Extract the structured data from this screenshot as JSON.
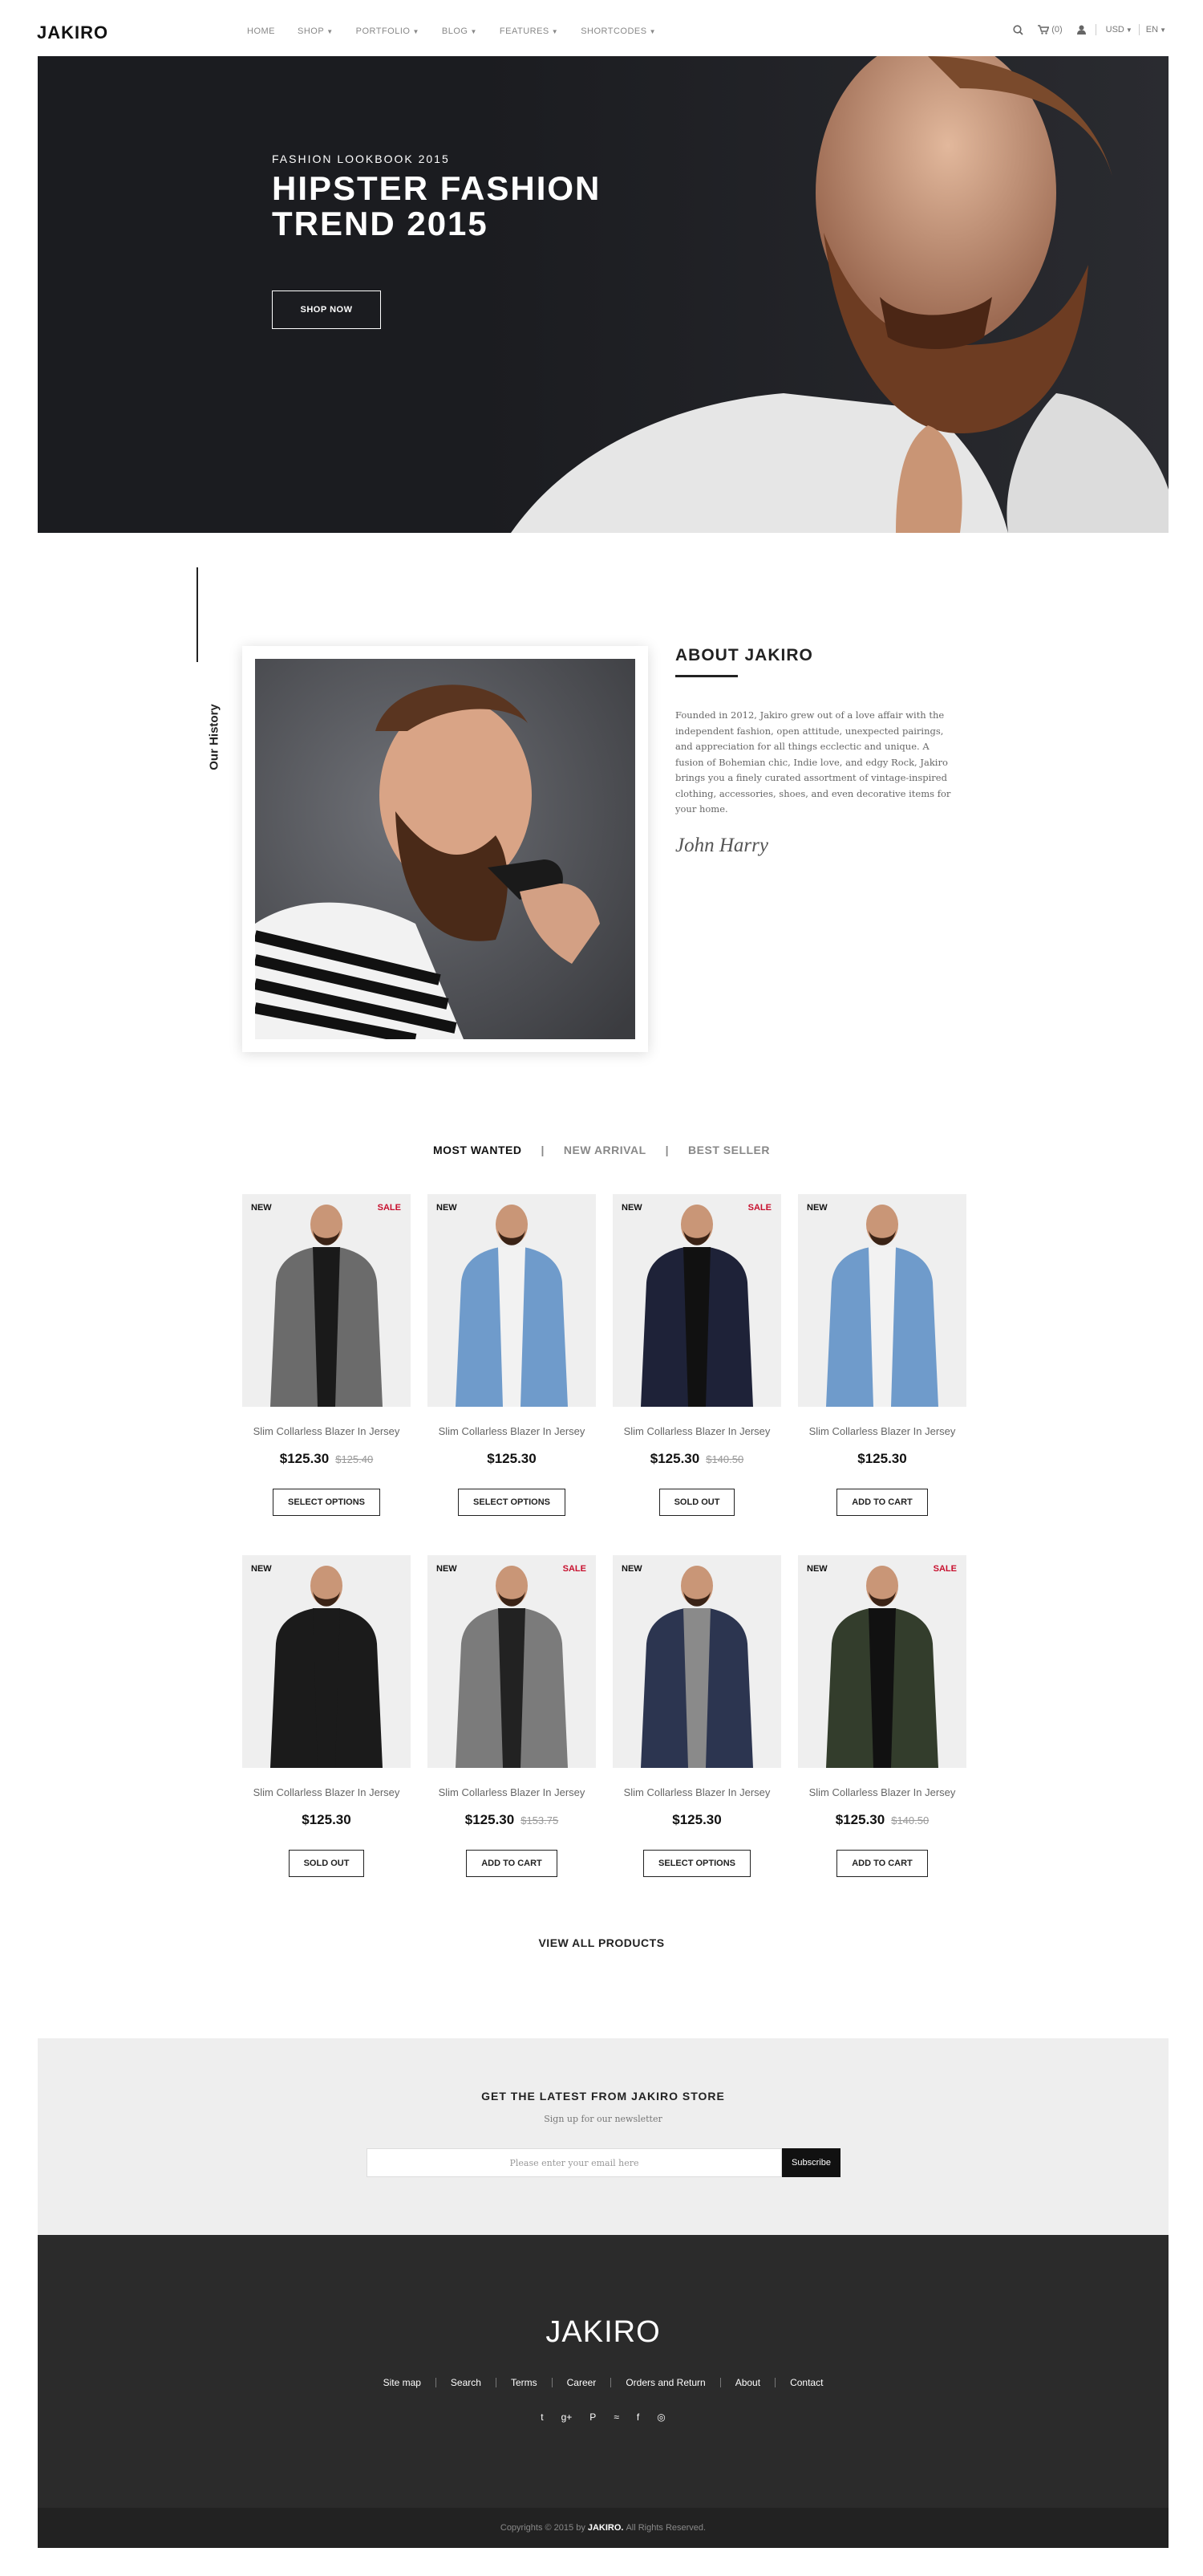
{
  "header": {
    "logo": "JAKIRO",
    "nav": [
      {
        "label": "HOME",
        "dropdown": false
      },
      {
        "label": "SHOP",
        "dropdown": true
      },
      {
        "label": "PORTFOLIO",
        "dropdown": true
      },
      {
        "label": "BLOG",
        "dropdown": true
      },
      {
        "label": "FEATURES",
        "dropdown": true
      },
      {
        "label": "SHORTCODES",
        "dropdown": true
      }
    ],
    "cart_count": "(0)",
    "currency": "USD",
    "language": "EN"
  },
  "hero": {
    "kicker": "FASHION LOOKBOOK 2015",
    "title": "HIPSTER FASHION TREND 2015",
    "button": "SHOP NOW"
  },
  "about": {
    "side_label": "Our History",
    "title": "ABOUT JAKIRO",
    "text": "Founded in 2012, Jakiro grew out of a love affair with the independent fashion, open attitude, unexpected pairings, and appreciation for all things ecclectic and unique. A fusion of Bohemian chic, Indie love, and edgy Rock, Jakiro brings you a finely curated assortment of vintage-inspired clothing, accessories, shoes, and even decorative items for your home.",
    "signature": "John Harry"
  },
  "tabs": [
    "MOST WANTED",
    "NEW ARRIVAL",
    "BEST SELLER"
  ],
  "products": [
    {
      "name": "Slim Collarless Blazer In Jersey",
      "price": "$125.30",
      "old_price": "$125.40",
      "badge_new": "NEW",
      "badge_sale": "SALE",
      "button": "SELECT OPTIONS",
      "jacket": "#6b6b6b",
      "top": "#1a1a1a"
    },
    {
      "name": "Slim Collarless Blazer In Jersey",
      "price": "$125.30",
      "old_price": "",
      "badge_new": "NEW",
      "badge_sale": "",
      "button": "SELECT OPTIONS",
      "jacket": "#6f9bcb",
      "top": "#f2f2f2"
    },
    {
      "name": "Slim Collarless Blazer In Jersey",
      "price": "$125.30",
      "old_price": "$140.50",
      "badge_new": "NEW",
      "badge_sale": "SALE",
      "button": "SOLD OUT",
      "jacket": "#1e2238",
      "top": "#111"
    },
    {
      "name": "Slim Collarless Blazer In Jersey",
      "price": "$125.30",
      "old_price": "",
      "badge_new": "NEW",
      "badge_sale": "",
      "button": "ADD TO CART",
      "jacket": "#6f9bcb",
      "top": "#f2f2f2"
    },
    {
      "name": "Slim Collarless Blazer In Jersey",
      "price": "$125.30",
      "old_price": "",
      "badge_new": "NEW",
      "badge_sale": "",
      "button": "SOLD OUT",
      "jacket": "#1b1b1b",
      "top": "#1b1b1b"
    },
    {
      "name": "Slim Collarless Blazer In Jersey",
      "price": "$125.30",
      "old_price": "$153.75",
      "badge_new": "NEW",
      "badge_sale": "SALE",
      "button": "ADD TO CART",
      "jacket": "#7b7b7b",
      "top": "#222"
    },
    {
      "name": "Slim Collarless Blazer In Jersey",
      "price": "$125.30",
      "old_price": "",
      "badge_new": "NEW",
      "badge_sale": "",
      "button": "SELECT OPTIONS",
      "jacket": "#2c3550",
      "top": "#8a8a8a"
    },
    {
      "name": "Slim Collarless Blazer In Jersey",
      "price": "$125.30",
      "old_price": "$140.50",
      "badge_new": "NEW",
      "badge_sale": "SALE",
      "button": "ADD TO CART",
      "jacket": "#333d2c",
      "top": "#111"
    }
  ],
  "view_all": "VIEW ALL PRODUCTS",
  "newsletter": {
    "title": "GET THE LATEST FROM JAKIRO STORE",
    "subtitle": "Sign up for our newsletter",
    "placeholder": "Please enter your email here",
    "button": "Subscribe"
  },
  "footer": {
    "logo": "JAKIRO",
    "links": [
      "Site map",
      "Search",
      "Terms",
      "Career",
      "Orders and Return",
      "About",
      "Contact"
    ],
    "social": [
      {
        "icon": "twitter-icon",
        "glyph": "t"
      },
      {
        "icon": "google-plus-icon",
        "glyph": "g+"
      },
      {
        "icon": "pinterest-icon",
        "glyph": "P"
      },
      {
        "icon": "rss-icon",
        "glyph": "≈"
      },
      {
        "icon": "facebook-icon",
        "glyph": "f"
      },
      {
        "icon": "dribbble-icon",
        "glyph": "◎"
      }
    ],
    "copyright_pre": "Copyrights © 2015 by",
    "copyright_brand": "JAKIRO.",
    "copyright_post": "All Rights Reserved."
  },
  "colors": {
    "accent_sale": "#c8102e",
    "hero_bg": "#1b1c20",
    "footer_bg": "#2b2b2b"
  }
}
